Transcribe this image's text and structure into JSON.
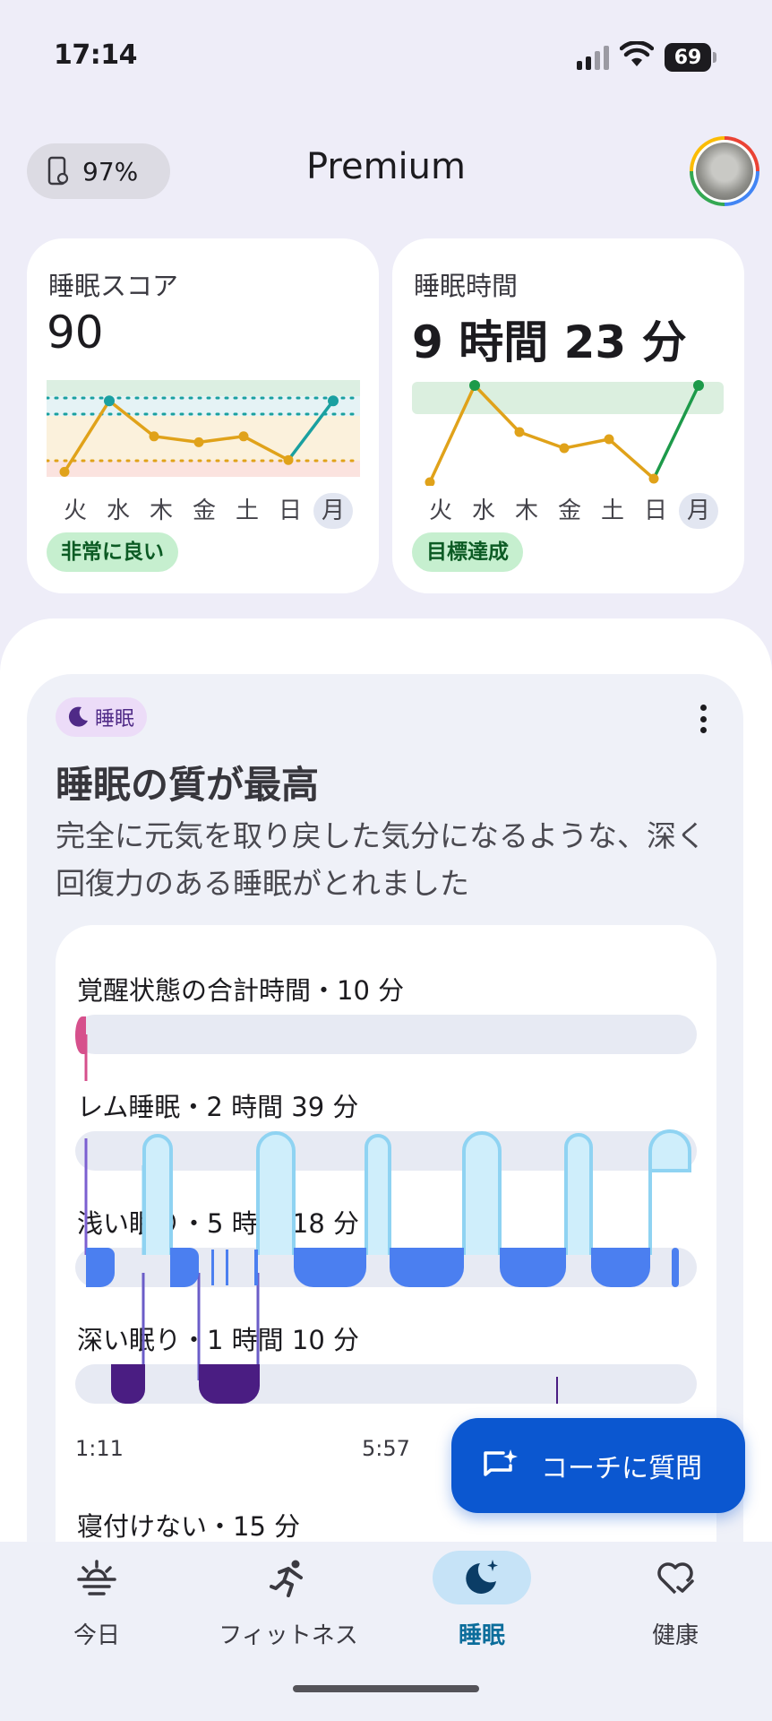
{
  "status_bar": {
    "time": "17:14",
    "battery": "69"
  },
  "header": {
    "device_battery": "97%",
    "title": "Premium"
  },
  "sleep_score_card": {
    "label": "睡眠スコア",
    "value": "90",
    "days": [
      "火",
      "水",
      "木",
      "金",
      "土",
      "日",
      "月"
    ],
    "today_index": 6,
    "scores": [
      80,
      92,
      86,
      85,
      86,
      82,
      92
    ],
    "badge": "非常に良い",
    "colors": {
      "line": "#e0a21a",
      "goal_line": "#1aa0a0",
      "above": "#1d9a4a"
    }
  },
  "sleep_time_card": {
    "label": "睡眠時間",
    "value": "9 時間 23 分",
    "days": [
      "火",
      "水",
      "木",
      "金",
      "土",
      "日",
      "月"
    ],
    "today_index": 6,
    "badge": "目標達成",
    "colors": {
      "line": "#e0a21a",
      "goal_band": "#dbefdf",
      "above": "#1d9a4a"
    }
  },
  "sleep_detail": {
    "tag": "睡眠",
    "title": "睡眠の質が最高",
    "description": "完全に元気を取り戻した気分になるような、深く回復力のある睡眠がとれました",
    "stages": {
      "awake": "覚醒状態の合計時間・10 分",
      "rem": "レム睡眠・2 時間 39 分",
      "light": "浅い眠り・5 時間 18 分",
      "deep": "深い眠り・1 時間 10 分",
      "fall_asleep": "寝付けない・15 分"
    },
    "time_axis": [
      "1:11",
      "5:57"
    ],
    "colors": {
      "awake": "#d6508c",
      "rem": "#8fd3f2",
      "light": "#4b7ff0",
      "deep": "#4a1d82",
      "track": "#e7eaf3"
    }
  },
  "coach_button": {
    "label": "コーチに質問"
  },
  "bottom_nav": {
    "items": [
      {
        "label": "今日",
        "icon": "sunrise-icon"
      },
      {
        "label": "フィットネス",
        "icon": "running-icon"
      },
      {
        "label": "睡眠",
        "icon": "moon-icon"
      },
      {
        "label": "健康",
        "icon": "heart-check-icon"
      }
    ],
    "active_index": 2
  }
}
